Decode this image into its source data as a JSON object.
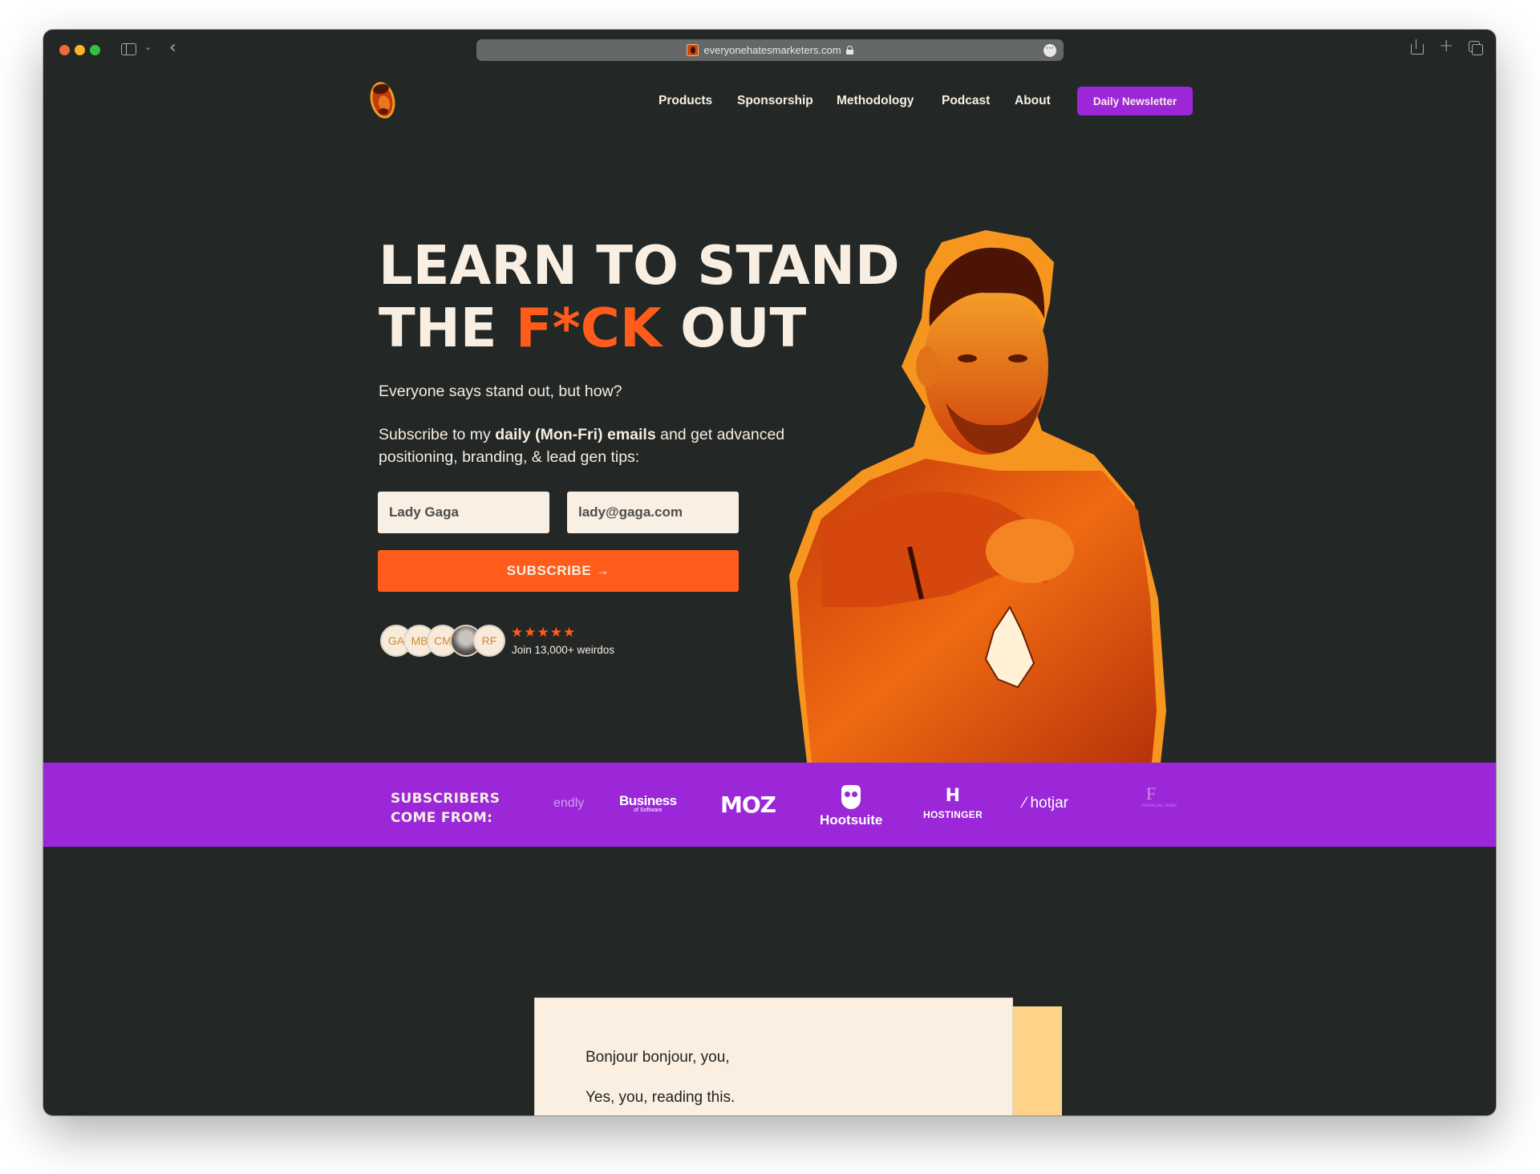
{
  "browser": {
    "url": "everyonehatesmarketers.com",
    "icons": [
      "sidebar-toggle-icon",
      "chevron-down-icon",
      "back-icon",
      "lock-icon",
      "more-icon",
      "share-icon",
      "new-tab-icon",
      "tab-overview-icon"
    ],
    "more_glyph": "···"
  },
  "nav": {
    "items": [
      {
        "label": "Products"
      },
      {
        "label": "Sponsorship"
      },
      {
        "label": "Methodology"
      },
      {
        "label": "Podcast"
      },
      {
        "label": "About"
      }
    ],
    "cta_label": "Daily Newsletter"
  },
  "hero": {
    "title_line1": "LEARN TO STAND",
    "title_line2_pre": "THE ",
    "title_line2_accent": "F*CK",
    "title_line2_post": " OUT",
    "subtitle": "Everyone says stand out, but how?",
    "desc_pre": "Subscribe to my ",
    "desc_bold": "daily (Mon-Fri) emails",
    "desc_post": " and get advanced positioning, branding, & lead gen tips:",
    "name_value": "Lady Gaga",
    "email_value": "lady@gaga.com",
    "subscribe_label": "SUBSCRIBE →",
    "avatars": [
      "GA",
      "MB",
      "CM",
      "",
      "RF"
    ],
    "rating_stars": 5,
    "stars_text": "★★★★★",
    "join_text": "Join 13,000+ weirdos"
  },
  "band": {
    "label_line1": "SUBSCRIBERS",
    "label_line2": "COME FROM:",
    "brands": {
      "calendly": "endly",
      "business_of_software": "Business",
      "business_of_software_sub": "of Software",
      "moz": "MOZ",
      "hootsuite": "Hootsuite",
      "hostinger": "HOSTINGER",
      "hostinger_mark": "H",
      "hotjar": "⁄ hotjar",
      "ft": "F",
      "ft_sub": "FINANCIAL TIMES"
    }
  },
  "letter": {
    "line1": "Bonjour bonjour, you,",
    "line2": "Yes, you, reading this."
  },
  "colors": {
    "background": "#232726",
    "accent_orange": "#ff5c1b",
    "brand_purple": "#9b27d8",
    "cream": "#f8efe2",
    "letter_shadow": "#fdd38a"
  }
}
